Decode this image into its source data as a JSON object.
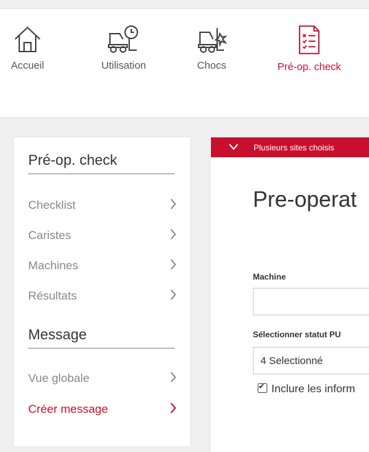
{
  "nav": {
    "items": [
      {
        "label": "Accueil",
        "icon": "home-icon"
      },
      {
        "label": "Utilisation",
        "icon": "forklift-clock-icon"
      },
      {
        "label": "Chocs",
        "icon": "forklift-impact-icon"
      },
      {
        "label": "Pré-op. check",
        "icon": "checklist-icon",
        "active": true
      }
    ]
  },
  "sidebar": {
    "sections": [
      {
        "title": "Pré-op. check",
        "items": [
          {
            "label": "Checklist"
          },
          {
            "label": "Caristes"
          },
          {
            "label": "Machines"
          },
          {
            "label": "Résultats"
          }
        ]
      },
      {
        "title": "Message",
        "items": [
          {
            "label": "Vue globale"
          },
          {
            "label": "Créer message",
            "active": true
          }
        ]
      }
    ]
  },
  "main": {
    "banner_text": "Plusieurs sites choisis",
    "title": "Pre-operat",
    "machine_label": "Machine",
    "machine_value": "",
    "status_label": "Sélectionner statut PU",
    "status_value": "4 Selectionné",
    "checkbox_label": "Inclure les inform",
    "checkbox_checked": true
  },
  "colors": {
    "accent": "#c8102e",
    "background": "#f0f0f0",
    "muted_text": "#888888"
  }
}
